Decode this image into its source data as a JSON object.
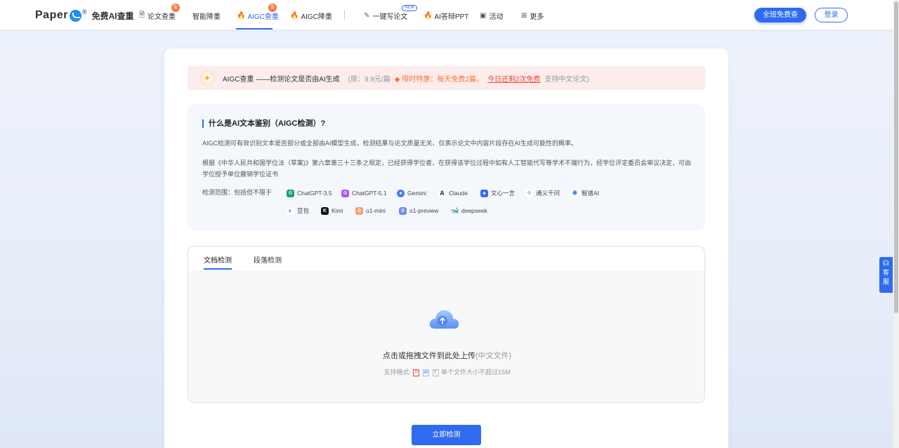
{
  "header": {
    "logo_text": "Paper",
    "logo_reg": "®",
    "logo_sub": "免费AI查重",
    "nav": [
      {
        "label": "论文查重",
        "badge": "免"
      },
      {
        "label": "智能降重"
      },
      {
        "label": "AIGC查重",
        "badge": "免"
      },
      {
        "label": "AIGC降重"
      },
      {
        "label": "一键写论文",
        "badge": "NEW"
      },
      {
        "label": "AI答辩PPT"
      },
      {
        "label": "活动"
      },
      {
        "label": "更多"
      }
    ],
    "cta_label": "全班免费查",
    "login_label": "登录"
  },
  "promo": {
    "title": "AIGC查重 ——检测论文是否由AI生成",
    "price": "(原：9.9元/篇",
    "tag": "限时特惠：每天免费2篇，",
    "remaining": "今日还剩2次免费",
    "support": "支持中文论文)"
  },
  "info": {
    "title": "什么是AI文本鉴别（AIGC检测）?",
    "p1": "AIGC检测可有效识别文本是否部分或全部由AI模型生成，检测结果与论文质量无关、仅表示论文中内容片段存在AI生成可能性的概率。",
    "p2": "根据《中华人民共和国学位法（草案)》第六章第三十三条之规定，已经获得学位者，在获得该学位过程中如有人工智能代写等学术不端行为，经学位评定委员会审议决定，可由学位授予单位撤销学位证书",
    "range_label": "检测范围：包括但不限于",
    "models": [
      "ChatGPT-3.5",
      "ChatGPT-5.1",
      "Gemini",
      "Claude",
      "文心一言",
      "通义千问",
      "智谱AI",
      "豆包",
      "Kimi",
      "o1-mini",
      "o1-preview",
      "deepseek"
    ]
  },
  "upload": {
    "tabs": [
      "文档检测",
      "段落检测"
    ],
    "main_text": "点击或拖拽文件到此处上传",
    "hint": "(中文文件)",
    "formats_label": "支持格式:",
    "format_icons": [
      "P",
      "W",
      "T"
    ],
    "size_limit": "单个文件大小不超过15M"
  },
  "detect_button": "立即检测",
  "side_service": {
    "chars": [
      "客",
      "服"
    ]
  },
  "colors": {
    "primary": "#2f6bf0",
    "accent_red": "#f04a3a",
    "accent_orange": "#f5743a"
  }
}
